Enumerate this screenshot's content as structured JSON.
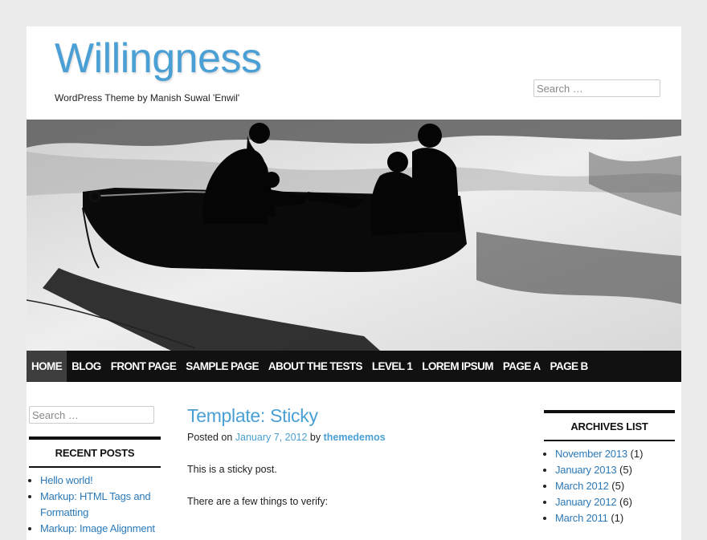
{
  "site": {
    "title": "Willingness",
    "description": "WordPress Theme by Manish Suwal 'Enwil'",
    "search_placeholder": "Search …"
  },
  "hero": {
    "alt": "Black and white photo of people in a boat silhouette"
  },
  "nav": {
    "items": [
      {
        "label": "HOME",
        "active": true
      },
      {
        "label": "BLOG"
      },
      {
        "label": "FRONT PAGE"
      },
      {
        "label": "SAMPLE PAGE"
      },
      {
        "label": "ABOUT THE TESTS"
      },
      {
        "label": "LEVEL 1"
      },
      {
        "label": "LOREM IPSUM"
      },
      {
        "label": "PAGE A"
      },
      {
        "label": "PAGE B"
      }
    ]
  },
  "left_sidebar": {
    "search_placeholder": "Search …",
    "recent_posts": {
      "title": "RECENT POSTS",
      "items": [
        "Hello world!",
        "Markup: HTML Tags and Formatting",
        "Markup: Image Alignment"
      ]
    }
  },
  "post": {
    "title": "Template: Sticky",
    "meta_prefix": "Posted on",
    "date": "January 7, 2012",
    "by": "by",
    "author": "themedemos",
    "paragraphs": [
      "This is a sticky post.",
      "There are a few things to verify:"
    ]
  },
  "right_sidebar": {
    "archives": {
      "title": "ARCHIVES LIST",
      "items": [
        {
          "label": "November 2013",
          "count": "(1)"
        },
        {
          "label": "January 2013",
          "count": "(5)"
        },
        {
          "label": "March 2012",
          "count": "(5)"
        },
        {
          "label": "January 2012",
          "count": "(6)"
        },
        {
          "label": "March 2011",
          "count": "(1)"
        }
      ]
    }
  }
}
